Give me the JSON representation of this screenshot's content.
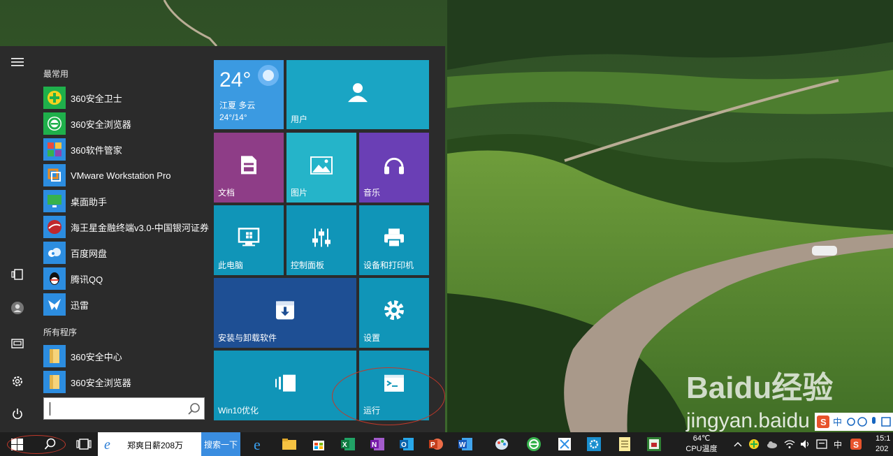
{
  "start_menu": {
    "rail": {
      "menu_icon": "hamburger-icon",
      "items": [
        {
          "name": "tablet-mode-icon"
        },
        {
          "name": "user-account-icon"
        },
        {
          "name": "documents-icon"
        },
        {
          "name": "settings-icon"
        },
        {
          "name": "power-icon"
        }
      ]
    },
    "most_used_label": "最常用",
    "most_used": [
      {
        "label": "360安全卫士",
        "icon": "360-safe-guard-icon",
        "color": "#2aa845"
      },
      {
        "label": "360安全浏览器",
        "icon": "360-browser-icon",
        "color": "#2aa845"
      },
      {
        "label": "360软件管家",
        "icon": "360-software-manager-icon",
        "color": "#e94b3c"
      },
      {
        "label": "VMware Workstation Pro",
        "icon": "vmware-icon",
        "color": "#f08c1c"
      },
      {
        "label": "桌面助手",
        "icon": "desktop-assistant-icon",
        "color": "#37b24d"
      },
      {
        "label": "海王星金融终端v3.0-中国银河证券",
        "icon": "neptune-finance-icon",
        "color": "#c0282d"
      },
      {
        "label": "百度网盘",
        "icon": "baidu-netdisk-icon",
        "color": "#2e8fe6"
      },
      {
        "label": "腾讯QQ",
        "icon": "qq-penguin-icon",
        "color": "#111111"
      },
      {
        "label": "迅雷",
        "icon": "thunder-bird-icon",
        "color": "#1b7fd6"
      }
    ],
    "all_programs_label": "所有程序",
    "all_programs": [
      {
        "label": "360安全中心",
        "icon": "folder-icon"
      },
      {
        "label": "360安全浏览器",
        "icon": "folder-icon"
      }
    ],
    "search": {
      "value": "",
      "icon": "magnifier-icon"
    }
  },
  "tiles": {
    "weather": {
      "temp": "24°",
      "desc": "江夏 多云",
      "range": "24°/14°",
      "icon": "sun-icon"
    },
    "user": {
      "label": "用户",
      "icon": "person-icon"
    },
    "documents": {
      "label": "文档",
      "icon": "document-icon"
    },
    "pictures": {
      "label": "图片",
      "icon": "picture-icon"
    },
    "music": {
      "label": "音乐",
      "icon": "headphones-icon"
    },
    "this_pc": {
      "label": "此电脑",
      "icon": "monitor-icon"
    },
    "control_panel": {
      "label": "控制面板",
      "icon": "sliders-icon"
    },
    "devices_printers": {
      "label": "设备和打印机",
      "icon": "printer-icon"
    },
    "install_uninstall": {
      "label": "安装与卸载软件",
      "icon": "box-download-icon"
    },
    "settings": {
      "label": "设置",
      "icon": "gear-icon"
    },
    "win10_optimize": {
      "label": "Win10优化",
      "icon": "optimize-icon"
    },
    "run": {
      "label": "运行",
      "icon": "terminal-icon"
    }
  },
  "taskbar": {
    "start_icon": "windows-logo-icon",
    "search_icon": "search-icon",
    "task_view_icon": "task-view-icon",
    "browser_search": {
      "text": "郑爽日薪208万",
      "button": "搜索一下",
      "icon": "ie-icon"
    },
    "pinned": [
      {
        "name": "edge-icon"
      },
      {
        "name": "file-explorer-icon"
      },
      {
        "name": "store-icon"
      },
      {
        "name": "excel-icon"
      },
      {
        "name": "onenote-icon"
      },
      {
        "name": "outlook-icon"
      },
      {
        "name": "powerpoint-icon"
      },
      {
        "name": "word-icon"
      },
      {
        "name": "paint-icon"
      },
      {
        "name": "360-browser-icon"
      },
      {
        "name": "snip-tool-icon"
      },
      {
        "name": "control-panel-icon"
      },
      {
        "name": "notepad-icon"
      },
      {
        "name": "photo-app-icon"
      }
    ],
    "cpu_temp": "64℃",
    "cpu_label": "CPU温度",
    "tray": {
      "ime": "中",
      "time": "15:1",
      "date": "202"
    }
  },
  "ime_bar": {
    "label": "中",
    "icon": "sogou-s-icon"
  },
  "watermark": {
    "brand": "Baidu经验",
    "url": "jingyan.baidu"
  }
}
